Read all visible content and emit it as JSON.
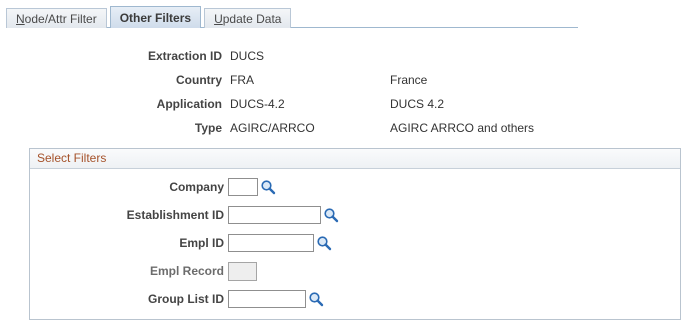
{
  "tabs": [
    {
      "label": "Node/Attr Filter",
      "access_key": "N",
      "rest": "ode/Attr Filter",
      "active": false
    },
    {
      "label": "Other Filters",
      "active": true
    },
    {
      "label": "Update Data",
      "access_key": "U",
      "rest": "pdate Data",
      "active": false
    }
  ],
  "header": {
    "extraction_id": {
      "label": "Extraction ID",
      "value": "DUCS",
      "desc": ""
    },
    "country": {
      "label": "Country",
      "value": "FRA",
      "desc": "France"
    },
    "application": {
      "label": "Application",
      "value": "DUCS-4.2",
      "desc": "DUCS 4.2"
    },
    "type": {
      "label": "Type",
      "value": "AGIRC/ARRCO",
      "desc": "AGIRC ARRCO and others"
    }
  },
  "filters": {
    "title": "Select Filters",
    "company": {
      "label": "Company",
      "value": ""
    },
    "establishment_id": {
      "label": "Establishment ID",
      "value": ""
    },
    "empl_id": {
      "label": "Empl ID",
      "value": ""
    },
    "empl_record": {
      "label": "Empl Record",
      "value": ""
    },
    "group_list_id": {
      "label": "Group List ID",
      "value": ""
    }
  },
  "colors": {
    "group_title": "#a5522a",
    "lookup_icon": "#2a6ab4",
    "tab_border": "#9fb8cf"
  },
  "icons": {
    "lookup": "magnifying-glass"
  }
}
